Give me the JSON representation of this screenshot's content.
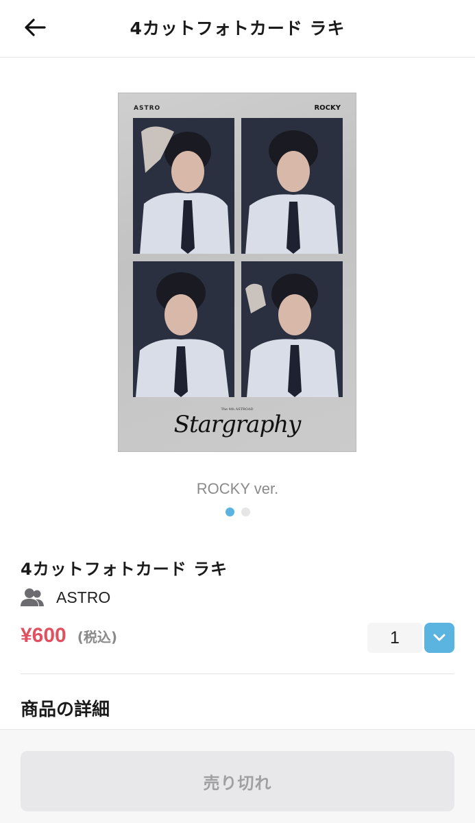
{
  "header": {
    "title": "4カットフォトカード ラキ",
    "back_icon": "arrow-left-icon"
  },
  "gallery": {
    "card_brand_left": "ASTRO",
    "card_brand_right": "ROCKY",
    "card_logo_small": "The 4th ASTROAD",
    "card_logo": "Stargraphy",
    "caption": "ROCKY ver.",
    "slide_count": 2,
    "active_slide": 1
  },
  "product": {
    "name": "4カットフォトカード ラキ",
    "artist_icon": "users-icon",
    "artist": "ASTRO",
    "price": "¥600",
    "tax_note": "(税込)",
    "quantity": "1",
    "quantity_dropdown_icon": "chevron-down-icon"
  },
  "details": {
    "section_title": "商品の詳細"
  },
  "footer": {
    "button_label": "売り切れ"
  },
  "colors": {
    "accent": "#5bb3e0",
    "price": "#e0505f",
    "disabled_bg": "#e8e8ea",
    "disabled_text": "#a0a0a4"
  }
}
